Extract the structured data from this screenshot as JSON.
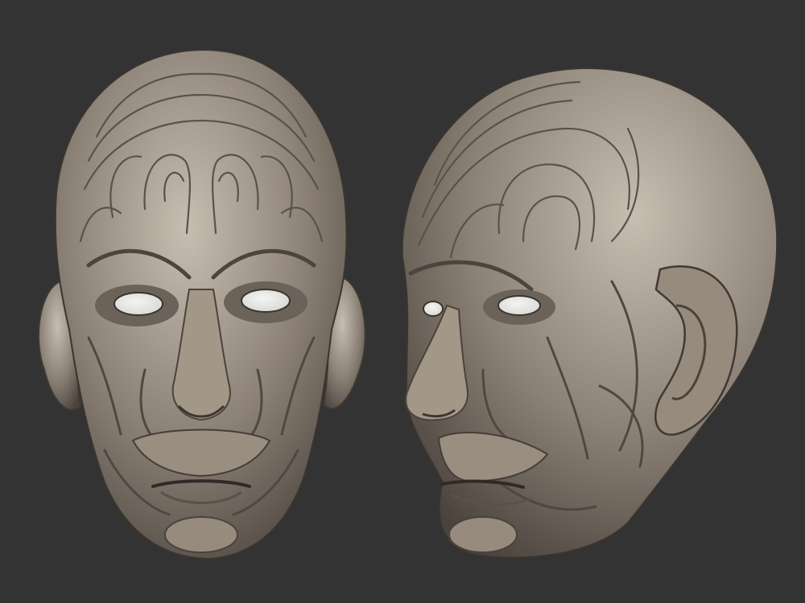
{
  "scene": {
    "background_color": "#333333",
    "clay_color": "#8c8176",
    "clay_highlight": "#c7bdb1",
    "clay_shadow": "#4a433c",
    "eye_color": "#d9d9d6",
    "subjects": [
      {
        "name": "front-view-head"
      },
      {
        "name": "three-quarter-view-head"
      }
    ]
  }
}
